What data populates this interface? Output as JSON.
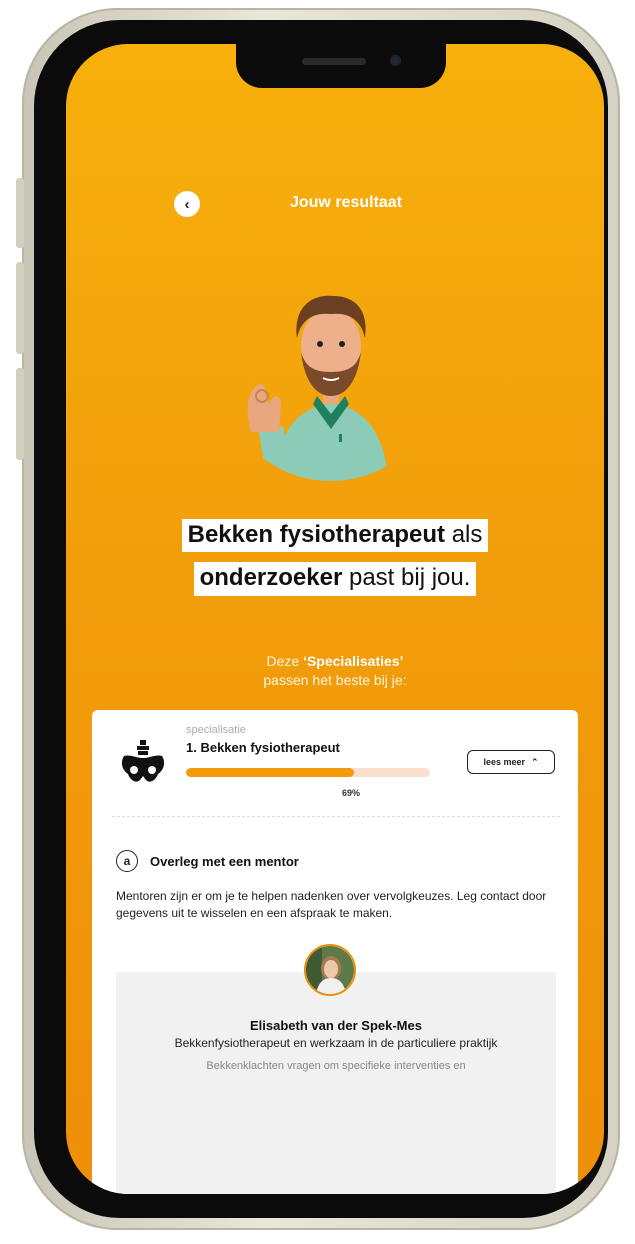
{
  "header": {
    "title": "Jouw resultaat",
    "back_icon": "chevron-left-icon"
  },
  "headline": {
    "line1_bold": "Bekken fysiotherapeut",
    "line1_rest": " als",
    "line2_bold": "onderzoeker",
    "line2_rest": " past bij jou."
  },
  "intro": {
    "prefix": "Deze ",
    "highlight": "‘Specialisaties’",
    "suffix": "passen het beste bij je:"
  },
  "card": {
    "category": "specialisatie",
    "title": "1. Bekken fysiotherapeut",
    "progress": 0.69,
    "percent_label": "69%",
    "button_label": "lees meer",
    "icon": "pelvis-icon",
    "step": {
      "badge": "a",
      "title": "Overleg met een mentor",
      "description": "Mentoren zijn er om je te helpen nadenken over vervolgkeuzes. Leg contact door gegevens uit te wisselen en een afspraak te maken."
    },
    "mentor": {
      "name": "Elisabeth van der Spek-Mes",
      "role": "Bekkenfysiotherapeut en werkzaam in de particuliere praktijk",
      "quote": "Bekkenklachten vragen om specifieke interventies en"
    }
  },
  "colors": {
    "accent": "#F39A0B",
    "background_top": "#F7B00C",
    "background_bottom": "#EE8F08"
  }
}
